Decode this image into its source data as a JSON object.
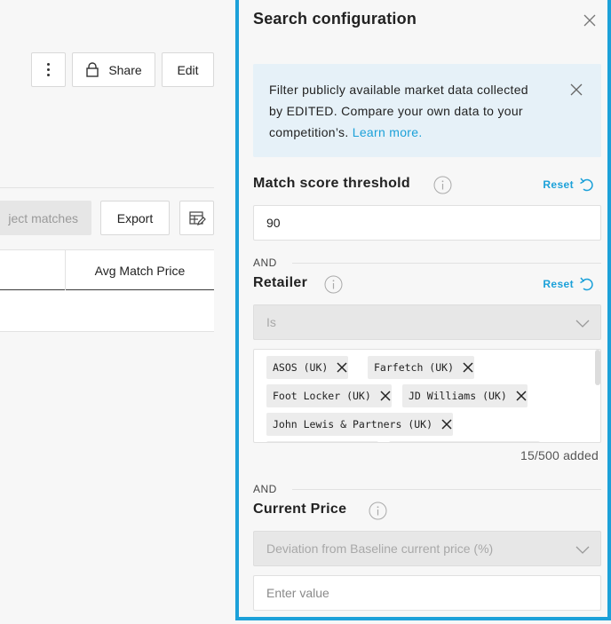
{
  "left": {
    "toolbar": {
      "share_label": "Share",
      "edit_label": "Edit"
    },
    "actions": {
      "reject_label": "ject matches",
      "export_label": "Export"
    },
    "table": {
      "columns": [
        "Avg Match Price"
      ]
    }
  },
  "panel": {
    "title": "Search configuration",
    "info": {
      "text": "Filter publicly available market data collected by EDITED. Compare your own data to your competition’s.",
      "link": "Learn more."
    },
    "match_score": {
      "label": "Match score threshold",
      "reset": "Reset",
      "value": "90"
    },
    "retailer": {
      "and": "AND",
      "label": "Retailer",
      "reset": "Reset",
      "operator": "Is",
      "tags": [
        "ASOS (UK)",
        "Farfetch (UK)",
        "Foot Locker (UK)",
        "JD Williams (UK)",
        "John Lewis & Partners (UK)"
      ],
      "count": "15/500 added"
    },
    "current_price": {
      "and": "AND",
      "label": "Current Price",
      "select": "Deviation from Baseline current price (%)",
      "placeholder": "Enter value"
    }
  },
  "colors": {
    "accent": "#1ca1d9",
    "info_bg": "#e6f1f8"
  }
}
